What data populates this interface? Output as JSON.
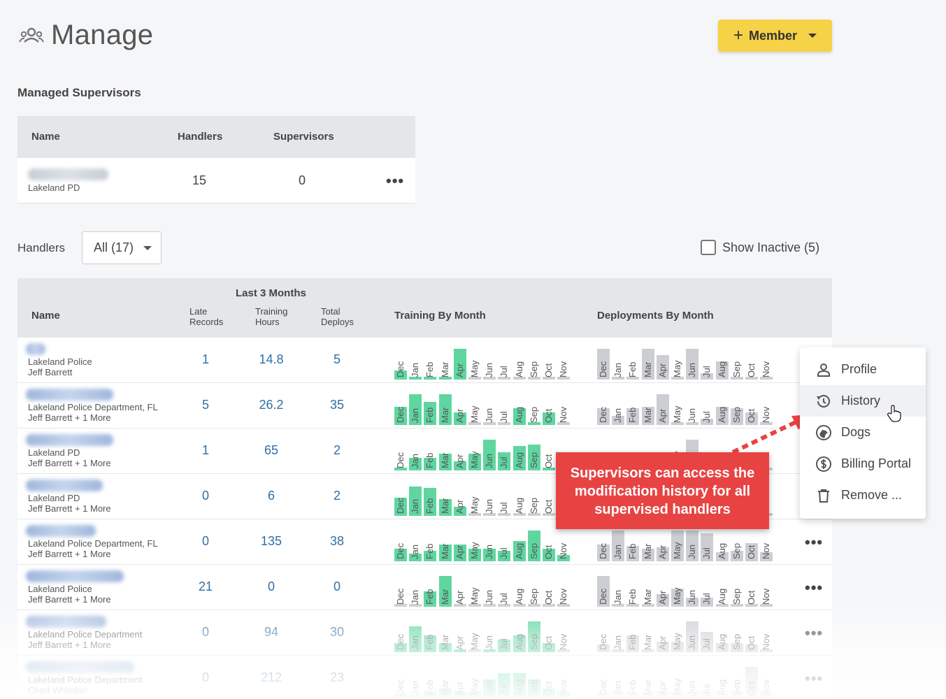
{
  "page": {
    "title": "Manage",
    "icon": "people-icon"
  },
  "member_button": {
    "plus": "+",
    "label": "Member"
  },
  "managed": {
    "section_title": "Managed Supervisors",
    "headers": {
      "name": "Name",
      "handlers": "Handlers",
      "supervisors": "Supervisors"
    },
    "rows": [
      {
        "org": "Lakeland PD",
        "handlers": "15",
        "supervisors": "0",
        "more": "•••"
      }
    ]
  },
  "handlers": {
    "section_title": "Handlers",
    "filter_value": "All (17)",
    "show_inactive": "Show Inactive (5)",
    "headers": {
      "group": "Last 3 Months",
      "name": "Name",
      "late_1": "Late",
      "late_2": "Records",
      "train_1": "Training",
      "train_2": "Hours",
      "deploy_1": "Total",
      "deploy_2": "Deploys",
      "training_by_month": "Training By Month",
      "deployments_by_month": "Deployments By Month"
    },
    "months": [
      "Dec",
      "Jan",
      "Feb",
      "Mar",
      "Apr",
      "May",
      "Jun",
      "Jul",
      "Aug",
      "Sep",
      "Oct",
      "Nov"
    ],
    "colors": {
      "training": "#5fd6a0",
      "deploy": "#ccced3"
    },
    "rows": [
      {
        "org": "Lakeland Police",
        "sup": "Jeff Barrett",
        "late": "1",
        "hours": "14.8",
        "deploys": "5",
        "training": [
          0.3,
          0.1,
          0.1,
          0.1,
          1,
          0,
          0,
          0,
          0,
          0,
          0,
          0
        ],
        "deployments": [
          1,
          0.1,
          0.1,
          1,
          0.8,
          0.1,
          1,
          0.2,
          0.6,
          0,
          0,
          0
        ],
        "more": ""
      },
      {
        "org": "Lakeland Police Department, FL",
        "sup": "Jeff Barrett + 1 More",
        "late": "5",
        "hours": "26.2",
        "deploys": "35",
        "training": [
          0.6,
          1,
          0.75,
          1,
          0.4,
          0,
          0,
          0,
          0.55,
          0.1,
          0.4,
          0
        ],
        "deployments": [
          0.55,
          0.3,
          0.55,
          0.6,
          1,
          0,
          0,
          0.2,
          0.6,
          0.55,
          0.4,
          0
        ],
        "more": ""
      },
      {
        "org": "Lakeland PD",
        "sup": "Jeff Barrett + 1 More",
        "late": "1",
        "hours": "65",
        "deploys": "2",
        "training": [
          0.1,
          0.4,
          0.4,
          0.55,
          0.3,
          0.55,
          1,
          0.6,
          0.8,
          0.85,
          0.1,
          0
        ],
        "deployments": [
          0,
          0,
          0,
          0,
          0,
          0,
          1,
          0,
          0,
          0,
          0,
          0
        ],
        "more": ""
      },
      {
        "org": "Lakeland PD",
        "sup": "Jeff Barrett + 1 More",
        "late": "0",
        "hours": "6",
        "deploys": "2",
        "training": [
          0.6,
          0.95,
          0.9,
          0.55,
          0.3,
          0,
          0,
          0,
          0,
          0,
          0,
          0
        ],
        "deployments": [
          0,
          0,
          0,
          0,
          0,
          0,
          0,
          0,
          0,
          0,
          0,
          0
        ],
        "more": ""
      },
      {
        "org": "Lakeland Police Department, FL",
        "sup": "Jeff Barrett + 1 More",
        "late": "0",
        "hours": "135",
        "deploys": "38",
        "training": [
          0.4,
          0.25,
          0.35,
          0.55,
          0.55,
          0.4,
          0.4,
          0.35,
          0.65,
          1,
          0.4,
          0.2
        ],
        "deployments": [
          0.55,
          1,
          0.5,
          0.4,
          0.45,
          1,
          1,
          0.9,
          0.3,
          0.35,
          0.6,
          0.3
        ],
        "more": "•••"
      },
      {
        "org": "Lakeland Police",
        "sup": "Jeff Barrett + 1 More",
        "late": "21",
        "hours": "0",
        "deploys": "0",
        "training": [
          0,
          0,
          0.5,
          1,
          0,
          0,
          0,
          0,
          0,
          0,
          0,
          0
        ],
        "deployments": [
          1,
          0,
          0,
          0.1,
          0.4,
          0.6,
          0.3,
          0.3,
          0,
          0,
          0,
          0
        ],
        "more": "•••"
      },
      {
        "org": "Lakeland Police Department",
        "sup": "Jeff Barrett + 1 More",
        "late": "0",
        "hours": "94",
        "deploys": "30",
        "training": [
          0.3,
          0.85,
          0.55,
          0.3,
          0.1,
          0,
          0.1,
          0.4,
          0.55,
          1,
          0.3,
          0
        ],
        "deployments": [
          0.25,
          0.1,
          0.55,
          0.1,
          0.35,
          0.35,
          1,
          0.65,
          0.3,
          0.3,
          0.25,
          0
        ],
        "more": "•••"
      },
      {
        "org": "Lakeland Police Department",
        "sup": "Chad Whitaker",
        "late": "0",
        "hours": "212",
        "deploys": "23",
        "training": [
          0.1,
          0.1,
          0.2,
          0.3,
          0.2,
          0.2,
          0.6,
          0.8,
          0.8,
          0.6,
          0.3,
          0.2
        ],
        "deployments": [
          0.2,
          0.2,
          0.2,
          0.2,
          0.2,
          0.2,
          0.2,
          0.2,
          0.2,
          0.2,
          1,
          0.2
        ],
        "more": "•••"
      }
    ]
  },
  "context_menu": {
    "items": [
      {
        "label": "Profile",
        "icon": "person-icon"
      },
      {
        "label": "History",
        "icon": "history-icon"
      },
      {
        "label": "Dogs",
        "icon": "dog-icon"
      },
      {
        "label": "Billing Portal",
        "icon": "dollar-icon"
      },
      {
        "label": "Remove ...",
        "icon": "trash-icon"
      }
    ]
  },
  "callout": {
    "text": "Supervisors can access the modification history for all supervised handlers"
  }
}
